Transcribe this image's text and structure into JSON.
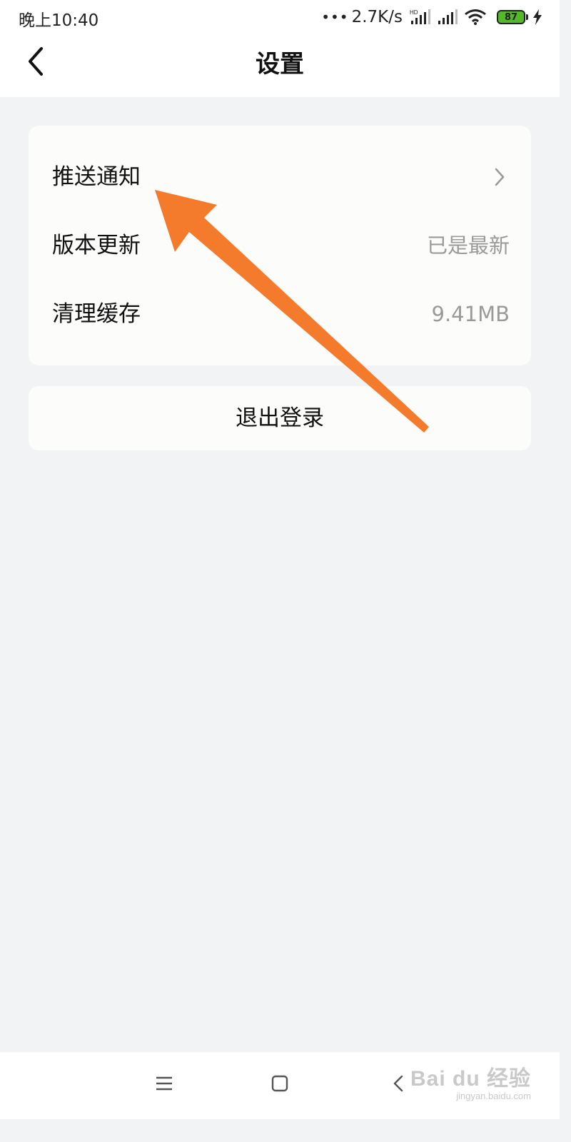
{
  "status_bar": {
    "time": "晚上10:40",
    "net_speed": "2.7K/s",
    "hd_label": "HD",
    "battery_level": "87",
    "battery_color": "#55b82b"
  },
  "header": {
    "title": "设置",
    "back_icon": "chevron-left-icon"
  },
  "settings": {
    "items": [
      {
        "label": "推送通知",
        "value": "",
        "icon": "chevron-right-icon"
      },
      {
        "label": "版本更新",
        "value": "已是最新"
      },
      {
        "label": "清理缓存",
        "value": "9.41MB"
      }
    ]
  },
  "logout": {
    "label": "退出登录"
  },
  "annotation": {
    "color": "#f47a2c"
  },
  "watermark": {
    "logo": "Bai du 经验",
    "url": "jingyan.baidu.com"
  },
  "nav_bar": {
    "icons": [
      "menu-icon",
      "home-icon",
      "back-icon"
    ]
  }
}
